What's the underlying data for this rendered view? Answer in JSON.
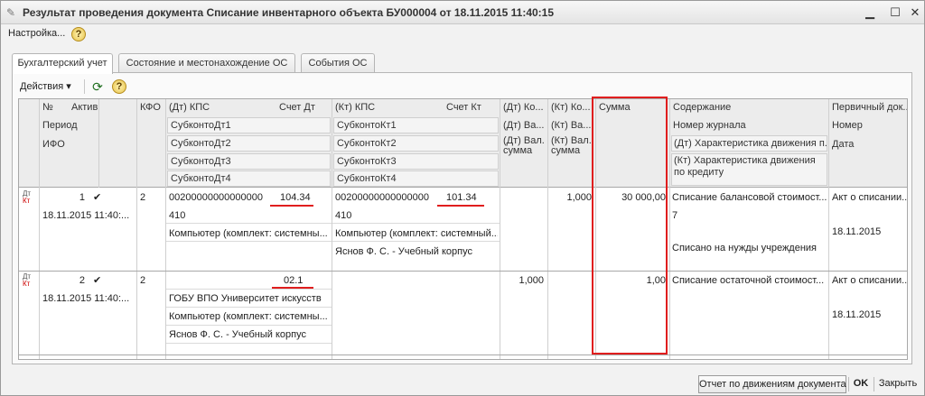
{
  "window": {
    "title": "Результат проведения документа Списание инвентарного объекта БУ000004 от 18.11.2015 11:40:15"
  },
  "menu": {
    "settings": "Настройка...",
    "help": "?"
  },
  "tabs": [
    "Бухгалтерский учет",
    "Состояние и местонахождение ОС",
    "События ОС"
  ],
  "toolbar": {
    "actions": "Действия",
    "help": "?"
  },
  "header": {
    "no": "№",
    "active": "Актив...",
    "kfo": "КФО",
    "period": "Период",
    "ifo": "ИФО",
    "dt_kps": "(Дт) КПС",
    "dt_account": "Счет Дт",
    "sub_dt1": "СубконтоДт1",
    "sub_dt2": "СубконтоДт2",
    "sub_dt3": "СубконтоДт3",
    "sub_dt4": "СубконтоДт4",
    "kt_kps": "(Кт) КПС",
    "kt_account": "Счет Кт",
    "sub_kt1": "СубконтоКт1",
    "sub_kt2": "СубконтоКт2",
    "sub_kt3": "СубконтоКт3",
    "sub_kt4": "СубконтоКт4",
    "dt_qty": "(Дт) Ко...",
    "dt_val": "(Дт) Ва...",
    "dt_val_sum": "(Дт) Вал. сумма",
    "kt_qty": "(Кт) Ко...",
    "kt_val": "(Кт) Ва...",
    "kt_val_sum": "(Кт) Вал. сумма",
    "sum": "Сумма",
    "content": "Содержание",
    "journal": "Номер журнала",
    "dt_char": "(Дт) Характеристика движения п...",
    "kt_char": "(Кт) Характеристика движения по кредиту",
    "primary_doc": "Первичный док...",
    "number": "Номер",
    "date": "Дата"
  },
  "rows": [
    {
      "no": "1",
      "date": "18.11.2015 11:40:...",
      "kfo": "2",
      "dt_kps": "00200000000000000",
      "dt_account": "104.34",
      "dt_sub1": "410",
      "dt_sub2": "Компьютер (комплект: системны...",
      "kt_kps": "00200000000000000",
      "kt_account": "101.34",
      "kt_sub1": "410",
      "kt_sub2": "Компьютер (комплект: системный...",
      "kt_sub3": "Яснов Ф. С. - Учебный корпус",
      "kt_qty": "1,000",
      "sum": "30 000,00",
      "content": "Списание балансовой стоимост...",
      "journal": "7",
      "kt_char": "Списано на нужды учреждения",
      "primary_doc": "Акт о списании...",
      "doc_date": "18.11.2015"
    },
    {
      "no": "2",
      "date": "18.11.2015 11:40:...",
      "kfo": "2",
      "dt_account": "02.1",
      "dt_sub1": "ГОБУ ВПО Университет искусств",
      "dt_sub2": "Компьютер (комплект: системны...",
      "dt_sub3": "Яснов Ф. С. - Учебный корпус",
      "dt_qty": "1,000",
      "sum": "1,00",
      "content": "Списание остаточной стоимост...",
      "primary_doc": "Акт о списании...",
      "doc_date": "18.11.2015"
    }
  ],
  "buttons": {
    "report": "Отчет по движениям документа",
    "ok": "OK",
    "close": "Закрыть"
  },
  "colors": {
    "highlight": "#e01e1e"
  }
}
